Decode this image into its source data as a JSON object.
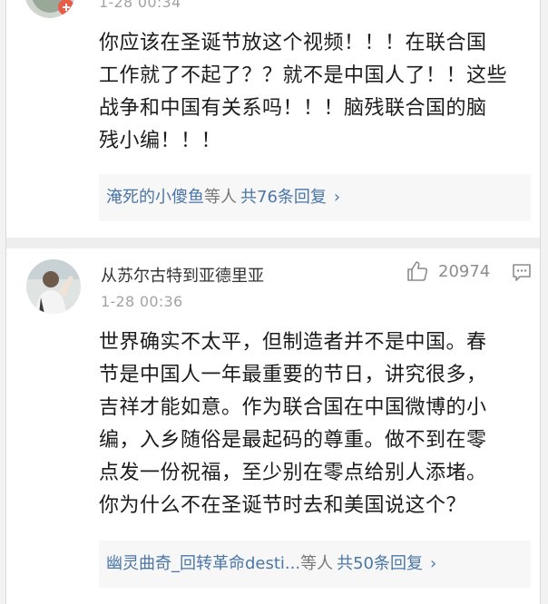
{
  "comment_top": {
    "time": "1-28 00:34",
    "body_lines": [
      "你应该在圣诞节放这个视频！！！在联合国",
      "工作就了不起了？？就不是中国人了！！这些",
      "战争和中国有关系吗！！！脑残联合国的脑",
      "残小编！！！"
    ],
    "reply_names": "淹死的小傻鱼",
    "reply_suffix": "等人",
    "reply_count": "共76条回复",
    "reply_chevron": "›"
  },
  "comment_bottom": {
    "username": "从苏尔古特到亚德里亚",
    "time": "1-28 00:36",
    "like_count": "20974",
    "body_lines": [
      "世界确实不太平，但制造者并不是中国。春",
      "节是中国人一年最重要的节日，讲究很多，",
      "吉祥才能如意。作为联合国在中国微博的小",
      "编，入乡随俗是最起码的尊重。做不到在零",
      "点发一份祝福，至少别在零点给别人添堵。",
      "你为什么不在圣诞节时去和美国说这个？"
    ],
    "reply_names": "幽灵曲奇_回转革命desti...",
    "reply_suffix": "等人",
    "reply_count": "共50条回复",
    "reply_chevron": "›"
  },
  "icons": {
    "like": "thumbs-up-icon",
    "comment": "comment-icon",
    "reply_more": "chevron-right-icon"
  },
  "colors": {
    "link": "#4a76a8",
    "timestamp": "#a3a3a3",
    "reply_bg": "#f7f7f7",
    "badge": "#e85d4a"
  }
}
